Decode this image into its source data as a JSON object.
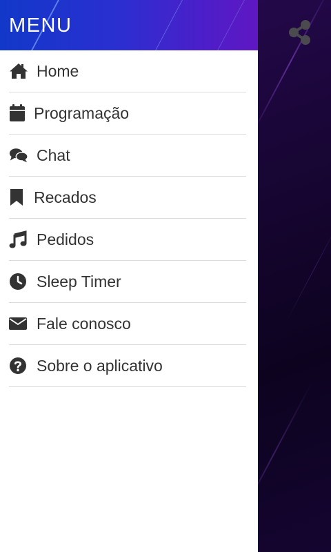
{
  "drawer": {
    "title": "MENU",
    "items": [
      {
        "label": "Home",
        "icon": "home-icon"
      },
      {
        "label": "Programação",
        "icon": "calendar-icon"
      },
      {
        "label": "Chat",
        "icon": "chat-icon"
      },
      {
        "label": "Recados",
        "icon": "bookmark-icon"
      },
      {
        "label": "Pedidos",
        "icon": "music-note-icon"
      },
      {
        "label": "Sleep Timer",
        "icon": "clock-icon"
      },
      {
        "label": "Fale conosco",
        "icon": "envelope-icon"
      },
      {
        "label": "Sobre o aplicativo",
        "icon": "help-circle-icon"
      }
    ]
  },
  "toolbar": {
    "share_icon": "share-icon"
  },
  "colors": {
    "header_start": "#1238c9",
    "header_end": "#5f17c2",
    "icon": "#333333",
    "text": "#333333",
    "divider": "#dcdcdc",
    "background": "#140530"
  }
}
